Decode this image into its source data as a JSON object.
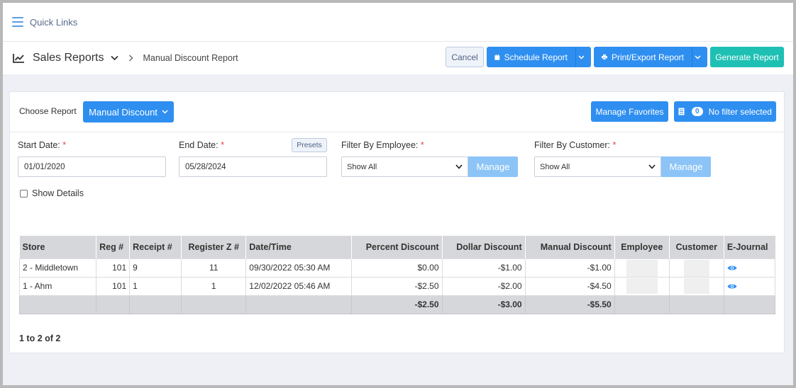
{
  "quick_links": {
    "label": "Quick Links"
  },
  "header": {
    "section": "Sales Reports",
    "breadcrumb": "Manual Discount Report",
    "cancel": "Cancel",
    "schedule": "Schedule Report",
    "print_export": "Print/Export Report",
    "generate": "Generate Report"
  },
  "chooser": {
    "label": "Choose Report",
    "selected": "Manual Discount",
    "manage_favorites": "Manage Favorites",
    "filter_count": "0",
    "filter_text": "No filter selected"
  },
  "filters": {
    "start_date_label": "Start Date:",
    "start_date": "01/01/2020",
    "end_date_label": "End Date:",
    "end_date": "05/28/2024",
    "presets": "Presets",
    "employee_label": "Filter By Employee:",
    "employee_value": "Show All",
    "customer_label": "Filter By Customer:",
    "customer_value": "Show All",
    "manage": "Manage",
    "required_mark": "*",
    "show_details": "Show Details"
  },
  "table": {
    "columns": [
      "Store",
      "Reg #",
      "Receipt #",
      "Register Z #",
      "Date/Time",
      "Percent Discount",
      "Dollar Discount",
      "Manual Discount",
      "Employee",
      "Customer",
      "E-Journal"
    ],
    "rows": [
      [
        "2 - Middletown",
        "101",
        "9",
        "11",
        "09/30/2022 05:30 AM",
        "$0.00",
        "-$1.00",
        "-$1.00"
      ],
      [
        "1 - Ahm",
        "101",
        "1",
        "1",
        "12/02/2022 05:46 AM",
        "-$2.50",
        "-$2.00",
        "-$4.50"
      ]
    ],
    "totals": [
      "-$2.50",
      "-$3.00",
      "-$5.50"
    ]
  },
  "pager": "1 to 2 of 2",
  "colors": {
    "primary": "#2f8ff0",
    "teal": "#1fc0b4",
    "manage": "#8cc4f7",
    "required": "#e0474c"
  }
}
